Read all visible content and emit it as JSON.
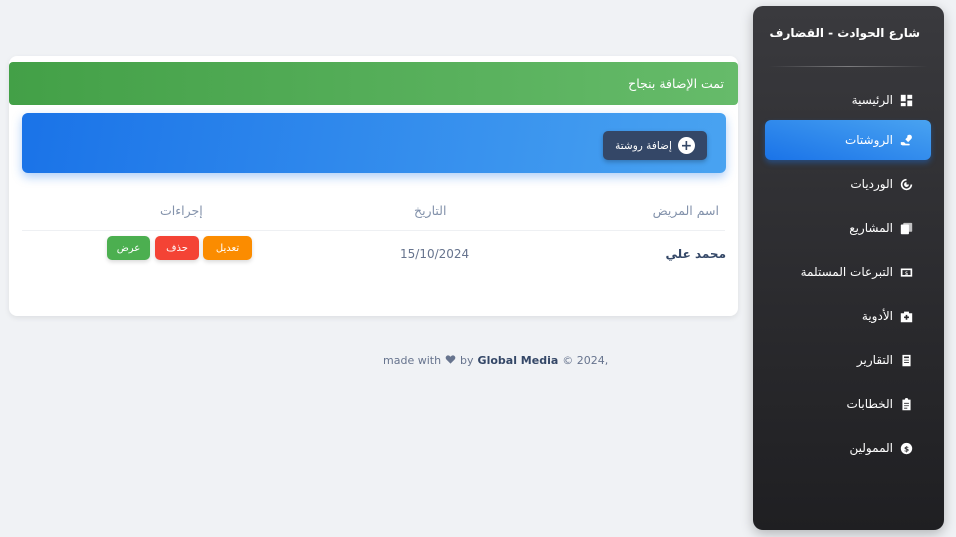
{
  "sidebar": {
    "brand": "شارع الحوادث - القضارف",
    "items": [
      {
        "label": "الرئيسية",
        "icon": "dashboard-icon",
        "active": false
      },
      {
        "label": "الروشتات",
        "icon": "prescription-icon",
        "active": true
      },
      {
        "label": "الورديات",
        "icon": "shift-icon",
        "active": false
      },
      {
        "label": "المشاريع",
        "icon": "projects-icon",
        "active": false
      },
      {
        "label": "التبرعات المستلمة",
        "icon": "donations-icon",
        "active": false
      },
      {
        "label": "الأدوية",
        "icon": "medicine-icon",
        "active": false
      },
      {
        "label": "التقارير",
        "icon": "reports-icon",
        "active": false
      },
      {
        "label": "الخطابات",
        "icon": "letters-icon",
        "active": false
      },
      {
        "label": "الممولين",
        "icon": "funders-icon",
        "active": false
      }
    ]
  },
  "alert": {
    "message": "تمت الإضافة بنجاح",
    "color": "#4caf50"
  },
  "banner": {
    "add_button_label": "إضافة روشتة",
    "color": "#1a73e8"
  },
  "table": {
    "headers": {
      "patient_name": "اسم المريض",
      "date": "التاريخ",
      "actions": "إجراءات"
    },
    "rows": [
      {
        "patient_name": "محمد علي",
        "date": "15/10/2024",
        "edit": "تعديل",
        "delete": "حذف",
        "view": "عرض"
      }
    ]
  },
  "footer": {
    "copyright": "© 2024,",
    "made_with": "made with",
    "by": "by",
    "brand": "Global Media"
  }
}
